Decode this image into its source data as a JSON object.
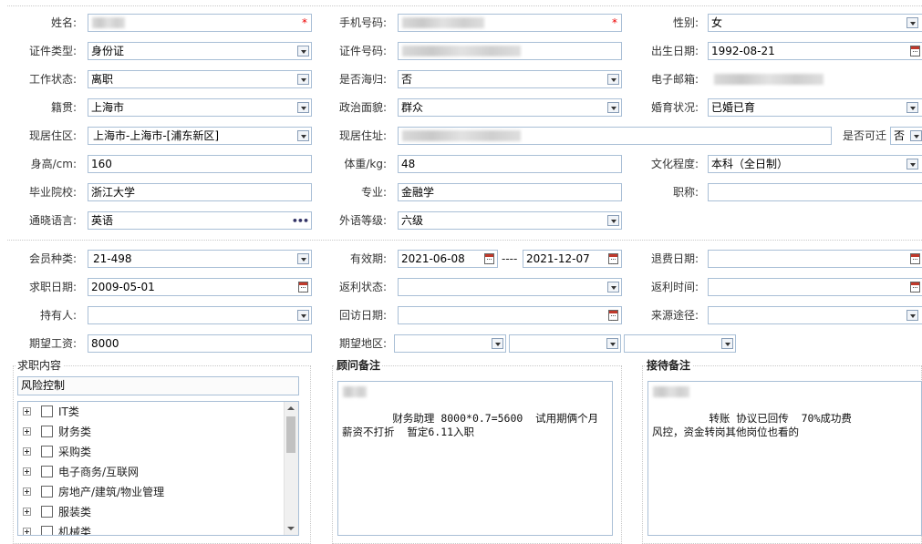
{
  "form": {
    "name_label": "姓名:",
    "phone_label": "手机号码:",
    "gender_label": "性别:",
    "gender_value": "女",
    "id_type_label": "证件类型:",
    "id_type_value": "身份证",
    "id_no_label": "证件号码:",
    "birth_label": "出生日期:",
    "birth_value": "1992-08-21",
    "work_status_label": "工作状态:",
    "work_status_value": "离职",
    "overseas_label": "是否海归:",
    "overseas_value": "否",
    "email_label": "电子邮箱:",
    "native_label": "籍贯:",
    "native_value": "上海市",
    "political_label": "政治面貌:",
    "political_value": "群众",
    "marital_label": "婚育状况:",
    "marital_value": "已婚已育",
    "residence_area_label": "现居住区:",
    "residence_area_value": "上海市-上海市-[浦东新区]",
    "address_label": "现居住址:",
    "relocate_label": "是否可迁",
    "relocate_value": "否",
    "height_label": "身高/cm:",
    "height_value": "160",
    "weight_label": "体重/kg:",
    "weight_value": "48",
    "education_label": "文化程度:",
    "education_value": "本科（全日制）",
    "school_label": "毕业院校:",
    "school_value": "浙江大学",
    "major_label": "专业:",
    "major_value": "金融学",
    "title_label": "职称:",
    "language_label": "通晓语言:",
    "language_value": "英语",
    "language_more": "•••",
    "lang_level_label": "外语等级:",
    "lang_level_value": "六级"
  },
  "membership": {
    "member_type_label": "会员种类:",
    "member_type_value": "21-498",
    "valid_label": "有效期:",
    "valid_from": "2021-06-08",
    "valid_sep": "----",
    "valid_to": "2021-12-07",
    "refund_date_label": "退费日期:",
    "job_date_label": "求职日期:",
    "job_date_value": "2009-05-01",
    "rebate_status_label": "返利状态:",
    "rebate_time_label": "返利时间:",
    "holder_label": "持有人:",
    "visit_date_label": "回访日期:",
    "source_label": "来源途径:",
    "salary_label": "期望工资:",
    "salary_value": "8000",
    "region_label": "期望地区:"
  },
  "job_content": {
    "legend": "求职内容",
    "selected": "风险控制",
    "tree": [
      "IT类",
      "财务类",
      "采购类",
      "电子商务/互联网",
      "房地产/建筑/物业管理",
      "服装类",
      "机械类"
    ]
  },
  "advisor_notes": {
    "legend": "顾问备注",
    "text": "      财务助理 8000*0.7=5600  试用期俩个月 薪资不打折  暂定6.11入职"
  },
  "reception_notes": {
    "legend": "接待备注",
    "text": "       转账 协议已回传  70%成功费\n风控，资金转岗其他岗位也看的"
  }
}
